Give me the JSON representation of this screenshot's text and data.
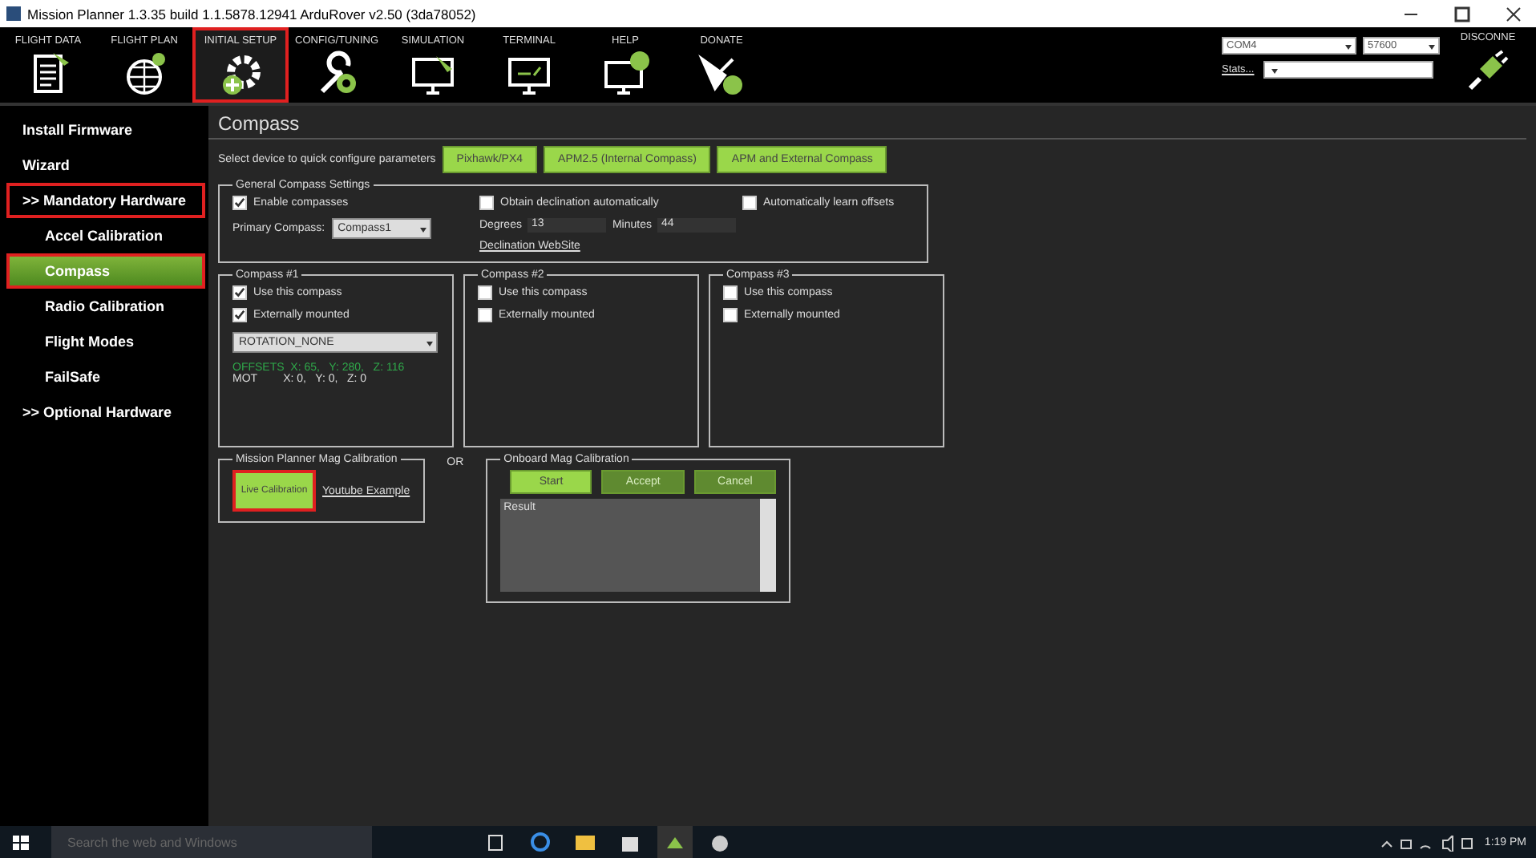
{
  "window": {
    "title": "Mission Planner 1.3.35 build 1.1.5878.12941 ArduRover v2.50 (3da78052)"
  },
  "toolbar": {
    "items": [
      {
        "label": "FLIGHT DATA",
        "selected": false,
        "highlighted": false
      },
      {
        "label": "FLIGHT PLAN",
        "selected": false,
        "highlighted": false
      },
      {
        "label": "INITIAL SETUP",
        "selected": true,
        "highlighted": true
      },
      {
        "label": "CONFIG/TUNING",
        "selected": false,
        "highlighted": false
      },
      {
        "label": "SIMULATION",
        "selected": false,
        "highlighted": false
      },
      {
        "label": "TERMINAL",
        "selected": false,
        "highlighted": false
      },
      {
        "label": "HELP",
        "selected": false,
        "highlighted": false
      },
      {
        "label": "DONATE",
        "selected": false,
        "highlighted": false
      }
    ],
    "port": "COM4",
    "baud": "57600",
    "stats_link": "Stats...",
    "connect_label": "DISCONNE"
  },
  "sidebar": {
    "items": [
      {
        "label": "Install Firmware",
        "selected": false,
        "highlighted": false
      },
      {
        "label": "Wizard",
        "selected": false,
        "highlighted": false
      },
      {
        "label": ">> Mandatory Hardware",
        "selected": false,
        "highlighted": true,
        "children": [
          {
            "label": "Accel Calibration",
            "selected": false,
            "highlighted": false
          },
          {
            "label": "Compass",
            "selected": true,
            "highlighted": true
          },
          {
            "label": "Radio Calibration",
            "selected": false,
            "highlighted": false
          },
          {
            "label": "Flight Modes",
            "selected": false,
            "highlighted": false
          },
          {
            "label": "FailSafe",
            "selected": false,
            "highlighted": false
          }
        ]
      },
      {
        "label": ">> Optional Hardware",
        "selected": false,
        "highlighted": false
      }
    ]
  },
  "page": {
    "title": "Compass",
    "quick_config": {
      "label": "Select device to quick configure parameters",
      "buttons": [
        "Pixhawk/PX4",
        "APM2.5 (Internal Compass)",
        "APM and External Compass"
      ]
    },
    "general": {
      "title": "General Compass Settings",
      "enable": {
        "label": "Enable compasses",
        "checked": true
      },
      "primary": {
        "label": "Primary Compass:",
        "value": "Compass1"
      },
      "obtain": {
        "label": "Obtain declination automatically",
        "checked": false
      },
      "degrees": {
        "label": "Degrees",
        "value": "13"
      },
      "minutes": {
        "label": "Minutes",
        "value": "44"
      },
      "link": "Declination WebSite",
      "auto_learn": {
        "label": "Automatically learn offsets",
        "checked": false
      }
    },
    "compasses": [
      {
        "title": "Compass #1",
        "use": {
          "label": "Use this compass",
          "checked": true
        },
        "external": {
          "label": "Externally mounted",
          "checked": true
        },
        "rotation": "ROTATION_NONE",
        "offsets": "OFFSETS  X: 65,   Y: 280,   Z: 116",
        "mot_label": "MOT",
        "mot": "X: 0,   Y: 0,   Z: 0"
      },
      {
        "title": "Compass #2",
        "use": {
          "label": "Use this compass",
          "checked": false
        },
        "external": {
          "label": "Externally mounted",
          "checked": false
        }
      },
      {
        "title": "Compass #3",
        "use": {
          "label": "Use this compass",
          "checked": false
        },
        "external": {
          "label": "Externally mounted",
          "checked": false
        }
      }
    ],
    "mp_calibration": {
      "title": "Mission Planner Mag Calibration",
      "button": {
        "label": "Live Calibration",
        "highlighted": true
      },
      "link": "Youtube Example"
    },
    "or_label": "OR",
    "onboard": {
      "title": "Onboard Mag Calibration",
      "buttons": [
        {
          "label": "Start",
          "disabled": false
        },
        {
          "label": "Accept",
          "disabled": true
        },
        {
          "label": "Cancel",
          "disabled": true
        }
      ],
      "result": "Result"
    }
  },
  "taskbar": {
    "search_placeholder": "Search the web and Windows",
    "time": "1:19 PM"
  }
}
